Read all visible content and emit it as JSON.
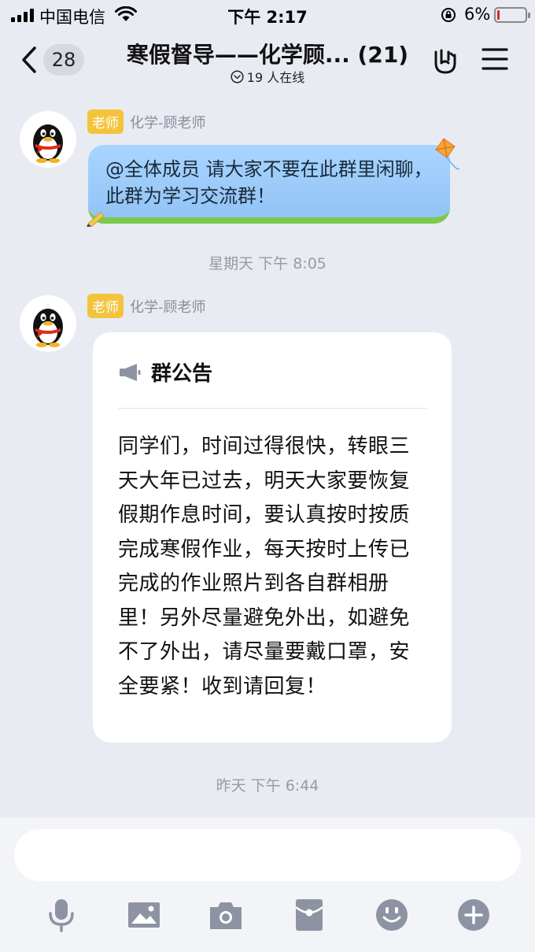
{
  "status_bar": {
    "carrier": "中国电信",
    "time": "下午 2:17",
    "battery": "6%"
  },
  "header": {
    "unread_count": "28",
    "title": "寒假督导——化学顾... (21)",
    "online": "19 人在线"
  },
  "messages": [
    {
      "role_badge": "老师",
      "sender": "化学-顾老师",
      "text": "@全体成员 请大家不要在此群里闲聊，此群为学习交流群！"
    },
    {
      "role_badge": "老师",
      "sender": "化学-顾老师",
      "notice_title": "群公告",
      "notice_body": "同学们，时间过得很快，转眼三天大年已过去，明天大家要恢复假期作息时间，要认真按时按质完成寒假作业，每天按时上传已完成的作业照片到各自群相册里！另外尽量避免外出，如避免不了外出，请尽量要戴口罩，安全要紧！收到请回复！"
    }
  ],
  "timestamps": [
    "星期天 下午 8:05",
    "昨天 下午 6:44"
  ],
  "input": {
    "value": ""
  },
  "toolbar": [
    "mic-icon",
    "image-icon",
    "camera-icon",
    "red-packet-icon",
    "emoji-icon",
    "plus-icon"
  ],
  "colors": {
    "badge": "#f3c43b",
    "bubble": "#a8d5ff",
    "background": "#e9ebf3"
  }
}
